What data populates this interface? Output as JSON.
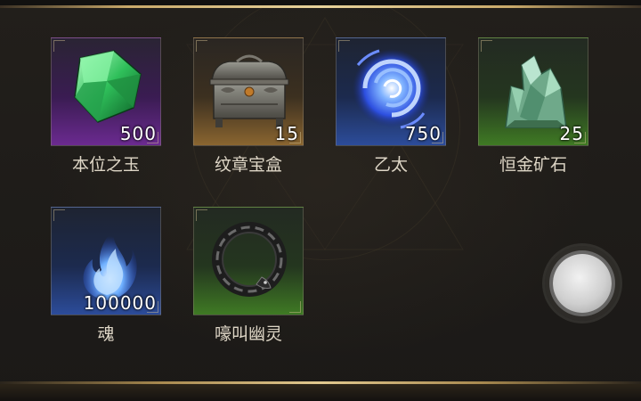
{
  "rewards": [
    {
      "name": "本位之玉",
      "count": "500",
      "rarity": "purple",
      "icon": "green-gem-icon"
    },
    {
      "name": "纹章宝盒",
      "count": "15",
      "rarity": "orange",
      "icon": "ornate-chest-icon"
    },
    {
      "name": "乙太",
      "count": "750",
      "rarity": "blue",
      "icon": "ether-vortex-icon"
    },
    {
      "name": "恒金矿石",
      "count": "25",
      "rarity": "green",
      "icon": "ore-crystal-icon"
    },
    {
      "name": "魂",
      "count": "100000",
      "rarity": "blue",
      "icon": "soul-flame-icon"
    },
    {
      "name": "嚎叫幽灵",
      "count": "",
      "rarity": "green",
      "icon": "dark-ring-icon"
    }
  ],
  "colors": {
    "purple": "#6b2a90",
    "orange": "#8a6530",
    "blue": "#2c4c9a",
    "green": "#3f7a24",
    "gold_border": "#c9a96a"
  },
  "controls": {
    "joystick_icon": "virtual-joystick-icon"
  }
}
